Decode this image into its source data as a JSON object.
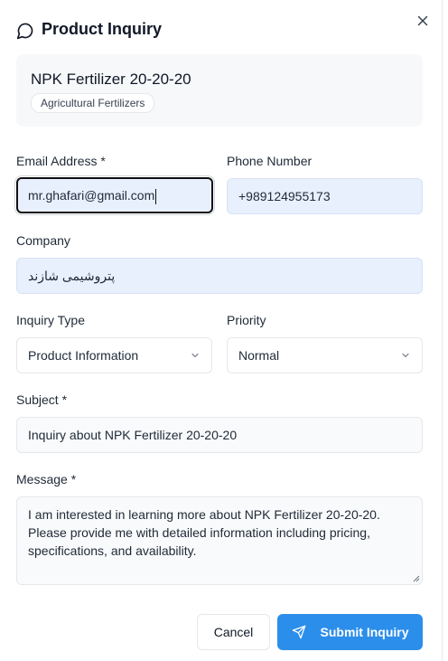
{
  "dialog": {
    "title": "Product Inquiry"
  },
  "product": {
    "name": "NPK Fertilizer 20-20-20",
    "category": "Agricultural Fertilizers"
  },
  "form": {
    "email": {
      "label": "Email Address *",
      "value": "mr.ghafari@gmail.com"
    },
    "phone": {
      "label": "Phone Number",
      "value": "+989124955173"
    },
    "company": {
      "label": "Company",
      "value": "پتروشیمی شازند"
    },
    "inquiry_type": {
      "label": "Inquiry Type",
      "value": "Product Information"
    },
    "priority": {
      "label": "Priority",
      "value": "Normal"
    },
    "subject": {
      "label": "Subject *",
      "value": "Inquiry about NPK Fertilizer 20-20-20"
    },
    "message": {
      "label": "Message *",
      "value": "I am interested in learning more about NPK Fertilizer 20-20-20.\nPlease provide me with detailed information including pricing,\nspecifications, and availability."
    }
  },
  "actions": {
    "cancel_label": "Cancel",
    "submit_label": "Submit Inquiry"
  },
  "icons": {
    "header": "message-circle-icon",
    "close": "close-icon",
    "submit": "send-icon",
    "dropdown": "chevron-down-icon"
  },
  "colors": {
    "primary": "#2b8eea",
    "autofill_bg": "#e8f0fe"
  }
}
